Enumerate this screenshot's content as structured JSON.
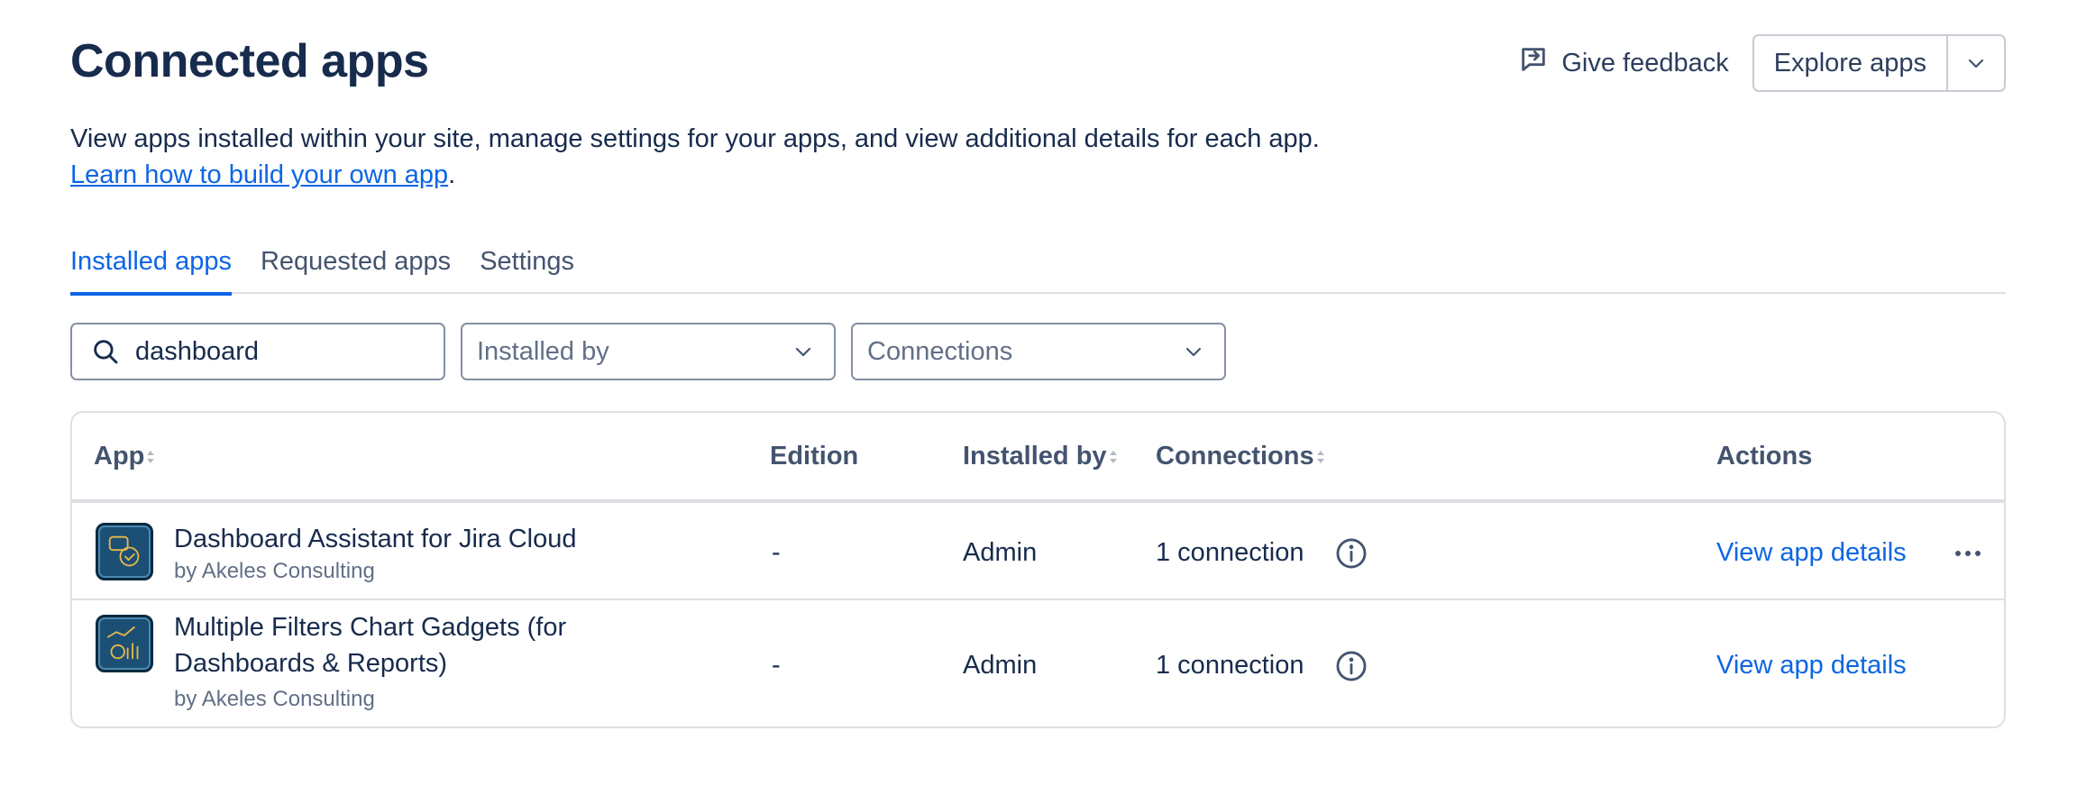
{
  "header": {
    "title": "Connected apps",
    "feedback_label": "Give feedback",
    "explore_label": "Explore apps"
  },
  "description": {
    "text": "View apps installed within your site, manage settings for your apps, and view additional details for each app.",
    "link_text": "Learn how to build your own app",
    "suffix": "."
  },
  "tabs": [
    {
      "label": "Installed apps",
      "active": true
    },
    {
      "label": "Requested apps",
      "active": false
    },
    {
      "label": "Settings",
      "active": false
    }
  ],
  "filters": {
    "search_value": "dashboard",
    "installed_by_placeholder": "Installed by",
    "connections_placeholder": "Connections"
  },
  "table": {
    "columns": {
      "app": "App",
      "edition": "Edition",
      "installed_by": "Installed by",
      "connections": "Connections",
      "actions": "Actions"
    },
    "rows": [
      {
        "name": "Dashboard Assistant for Jira Cloud",
        "name_line2": "",
        "vendor": "by Akeles Consulting",
        "edition": "-",
        "installed_by": "Admin",
        "connections": "1 connection",
        "action": "View app details"
      },
      {
        "name": "Multiple Filters Chart Gadgets (for",
        "name_line2": "Dashboards & Reports)",
        "vendor": "by Akeles Consulting",
        "edition": "-",
        "installed_by": "Admin",
        "connections": "1 connection",
        "action": "View app details"
      }
    ]
  },
  "colors": {
    "accent": "#0c66e4",
    "text": "#172b4d",
    "subtle_text": "#626f86",
    "border": "#dcdfe4"
  }
}
